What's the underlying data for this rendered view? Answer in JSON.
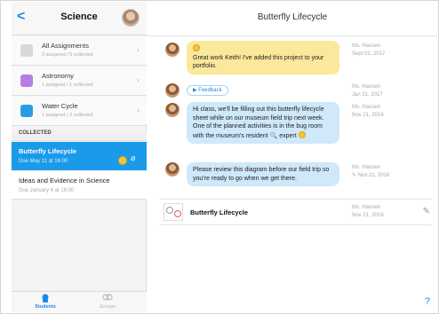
{
  "sidebar": {
    "back_glyph": "<",
    "title": "Science",
    "folders": [
      {
        "name": "All Assignments",
        "sub": "3 assigned / 5 collected",
        "icon": "list-icon",
        "color": "#d8d8dc"
      },
      {
        "name": "Astronomy",
        "sub": "1 assigned / 1 collected",
        "icon": "folder-icon",
        "color": "#b57ee6"
      },
      {
        "name": "Water Cycle",
        "sub": "1 assigned / 2 collected",
        "icon": "folder-icon",
        "color": "#2a9de0"
      }
    ],
    "section_label": "COLLECTED",
    "selected": {
      "name": "Butterfly Lifecycle",
      "sub": "Due May 11 at 16:00"
    },
    "other": {
      "name": "Ideas and Evidence in Science",
      "sub": "Due January 4 at 16:00"
    },
    "tabs": [
      {
        "label": "Students",
        "icon": "students-icon"
      },
      {
        "label": "Groups",
        "icon": "groups-icon"
      }
    ]
  },
  "main": {
    "title": "Butterfly Lifecycle",
    "messages": [
      {
        "text": "Great work Keith! I've added this project to your portfolio.",
        "author": "Ms. Hansen",
        "date": "Sept 02, 2017"
      },
      {
        "pill": "Feedback",
        "author": "Ms. Hansen",
        "date": "Jan 31, 2017"
      },
      {
        "text": "Hi class, we'll be filling out this butterfly lifecycle sheet while on our museum field trip next week. One of the planned activities is in the bug room with the museum's resident",
        "text_end": "expert",
        "author": "Ms. Hansen",
        "date": "Nov 21, 2016"
      },
      {
        "text": "Please review this diagram before our field trip so you're ready to go when we get there.",
        "author": "Ms. Hansen",
        "date": "Nov 21, 2016"
      }
    ],
    "document": {
      "name": "Butterfly Lifecycle",
      "author": "Ms. Hansen",
      "date": "Nov 21, 2016"
    },
    "help": "?"
  },
  "colors": {
    "accent": "#1a8ae6",
    "selected_bg": "#1a9ae8",
    "yellow_bubble": "#fbe89a",
    "blue_bubble": "#cfe8fa"
  }
}
